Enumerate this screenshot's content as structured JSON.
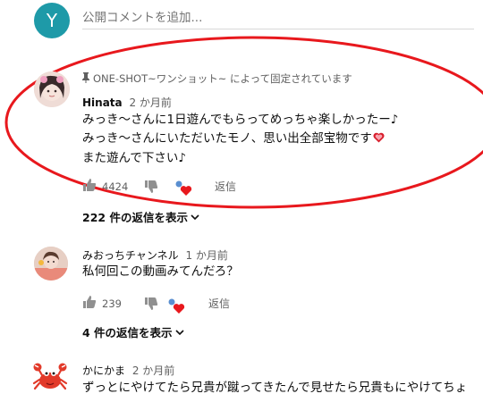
{
  "composer": {
    "avatar_letter": "Y",
    "avatar_color": "#1e9aa8",
    "placeholder": "公開コメントを追加..."
  },
  "comments": [
    {
      "pinned_text": "ONE-SHOT~ワンショット~ によって固定されています",
      "author": "Hinata",
      "time": "2 か月前",
      "lines": [
        "みっき～さんに1日遊んでもらってめっちゃ楽しかったー♪",
        "みっき～さんにいただいたモノ、思い出全部宝物です",
        "また遊んで下さい♪"
      ],
      "likes": "4424",
      "reply_label": "返信",
      "view_replies": "222 件の返信を表示"
    },
    {
      "author": "みおっちチャンネル",
      "time": "1 か月前",
      "lines": [
        "私何回この動画みてんだろ？"
      ],
      "likes": "239",
      "reply_label": "返信",
      "view_replies": "4 件の返信を表示"
    },
    {
      "author": "かにかま",
      "time": "2 か月前",
      "lines": [
        "ずっとにやけてたら兄貴が蹴ってきたんで見せたら兄貴もにやけてちょ"
      ]
    }
  ],
  "colors": {
    "highlight_ellipse": "#e8181d",
    "heart": "#e8181d"
  },
  "icons": [
    "pin-icon",
    "thumbs-up-icon",
    "thumbs-down-icon",
    "creator-heart-icon",
    "chevron-down-icon",
    "crab-icon"
  ]
}
